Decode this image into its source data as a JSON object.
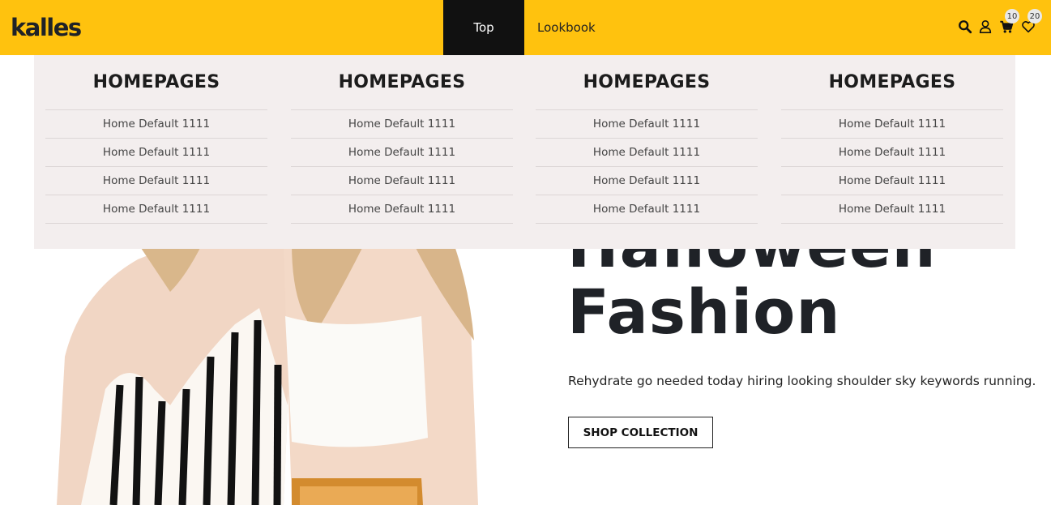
{
  "header": {
    "logo": "kalles",
    "nav": [
      {
        "label": "Top",
        "active": true
      },
      {
        "label": "Lookbook",
        "active": false
      }
    ],
    "icons": [
      "search-icon",
      "user-icon",
      "cart-icon",
      "heart-icon"
    ],
    "cart_count": "10",
    "wishlist_count": "20",
    "colors": {
      "bar": "#ffc20e",
      "active_nav": "#111111"
    }
  },
  "mega_menu": {
    "columns": [
      {
        "title": "HOMEPAGES",
        "items": [
          "Home Default 1111",
          "Home Default 1111",
          "Home Default 1111",
          "Home Default 1111"
        ]
      },
      {
        "title": "HOMEPAGES",
        "items": [
          "Home Default 1111",
          "Home Default 1111",
          "Home Default 1111",
          "Home Default 1111"
        ]
      },
      {
        "title": "HOMEPAGES",
        "items": [
          "Home Default 1111",
          "Home Default 1111",
          "Home Default 1111",
          "Home Default 1111"
        ]
      },
      {
        "title": "HOMEPAGES",
        "items": [
          "Home Default 1111",
          "Home Default 1111",
          "Home Default 1111",
          "Home Default 1111"
        ]
      }
    ]
  },
  "hero": {
    "title_line1": "Halloween",
    "title_line2": "Fashion",
    "subtitle": "Rehydrate go needed today hiring looking shoulder sky keywords running.",
    "button": "SHOP COLLECTION"
  }
}
